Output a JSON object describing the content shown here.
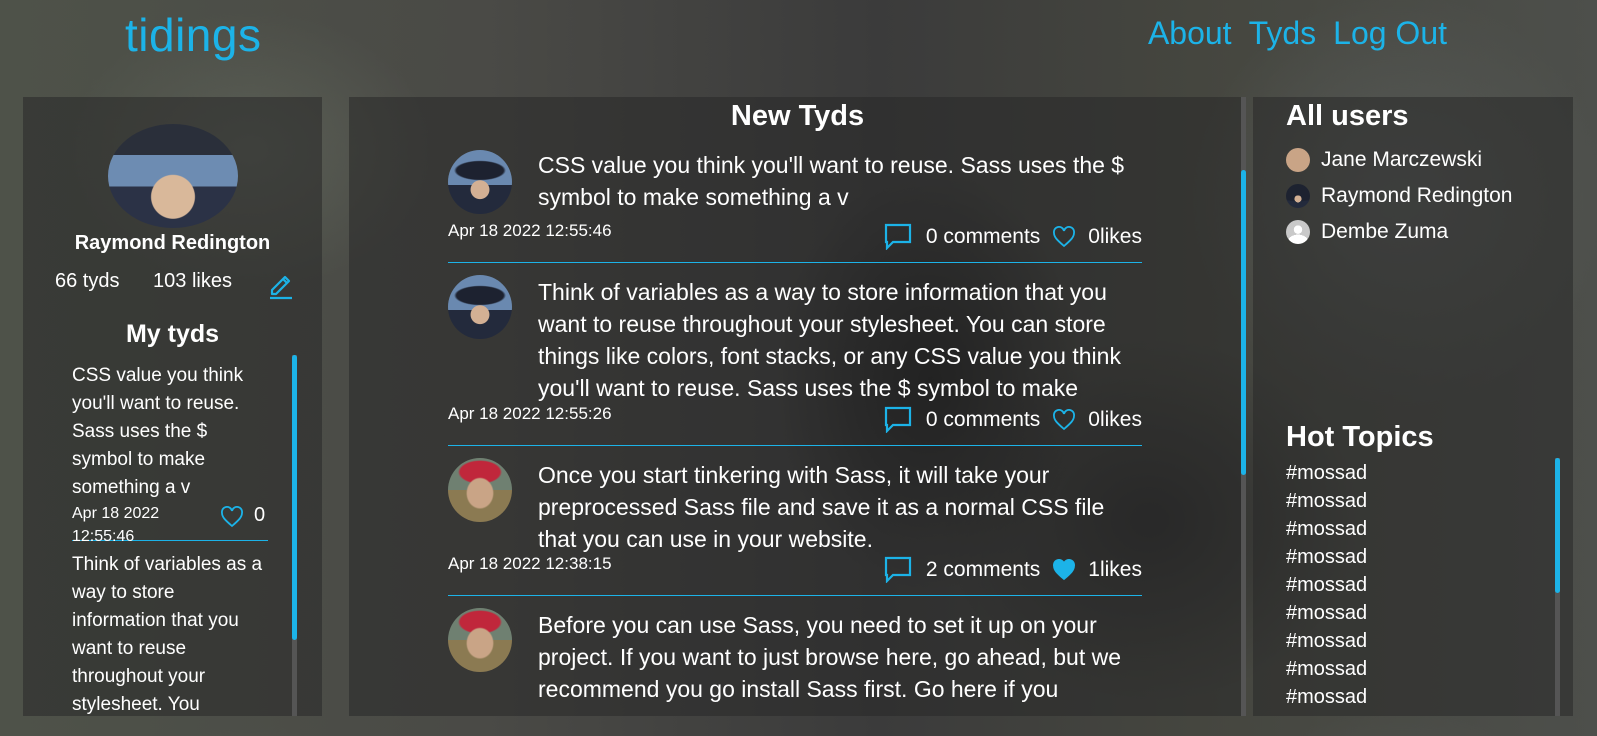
{
  "brand": "tidings",
  "nav": {
    "about": "About",
    "tyds": "Tyds",
    "logout": "Log Out"
  },
  "profile": {
    "name": "Raymond Redington",
    "tyds_count": "66 tyds",
    "likes_count": "103 likes",
    "my_tyds_title": "My tyds",
    "my_tyds": [
      {
        "text": "CSS value you think you'll want to reuse. Sass uses the $ symbol to make something a v",
        "date": "Apr 18 2022 12:55:46",
        "likes": "0"
      },
      {
        "text": "Think of variables as a way to store information that you want to reuse throughout your stylesheet. You",
        "date": "",
        "likes": ""
      }
    ]
  },
  "feed": {
    "title": "New Tyds",
    "posts": [
      {
        "avatar": "raymond",
        "text": "CSS value you think you'll want to reuse. Sass uses the $ symbol to make something a v",
        "date": "Apr 18 2022 12:55:46",
        "comments": "0 comments",
        "likes": "0likes",
        "liked": false
      },
      {
        "avatar": "raymond",
        "text": "Think of variables as a way to store information that you want to reuse throughout your stylesheet. You can store things like colors, font stacks, or any CSS value you think you'll want to reuse. Sass uses the $ symbol to make",
        "date": "Apr 18 2022 12:55:26",
        "comments": "0 comments",
        "likes": "0likes",
        "liked": false
      },
      {
        "avatar": "jane",
        "text": "Once you start tinkering with Sass, it will take your preprocessed Sass file and save it as a normal CSS file that you can use in your website.",
        "date": "Apr 18 2022 12:38:15",
        "comments": "2 comments",
        "likes": "1likes",
        "liked": true
      },
      {
        "avatar": "jane",
        "text": "Before you can use Sass, you need to set it up on your project. If you want to just browse here, go ahead, but we recommend you go install Sass first. Go here if you",
        "date": "",
        "comments": "",
        "likes": "",
        "liked": false
      }
    ]
  },
  "users": {
    "title": "All users",
    "list": [
      {
        "name": "Jane Marczewski",
        "avatar": "jane"
      },
      {
        "name": "Raymond Redington",
        "avatar": "raymond"
      },
      {
        "name": "Dembe Zuma",
        "avatar": "default"
      }
    ]
  },
  "topics": {
    "title": "Hot Topics",
    "list": [
      "#mossad",
      "#mossad",
      "#mossad",
      "#mossad",
      "#mossad",
      "#mossad",
      "#mossad",
      "#mossad",
      "#mossad"
    ]
  },
  "colors": {
    "accent": "#1cb3e8",
    "text": "#ffffff"
  }
}
